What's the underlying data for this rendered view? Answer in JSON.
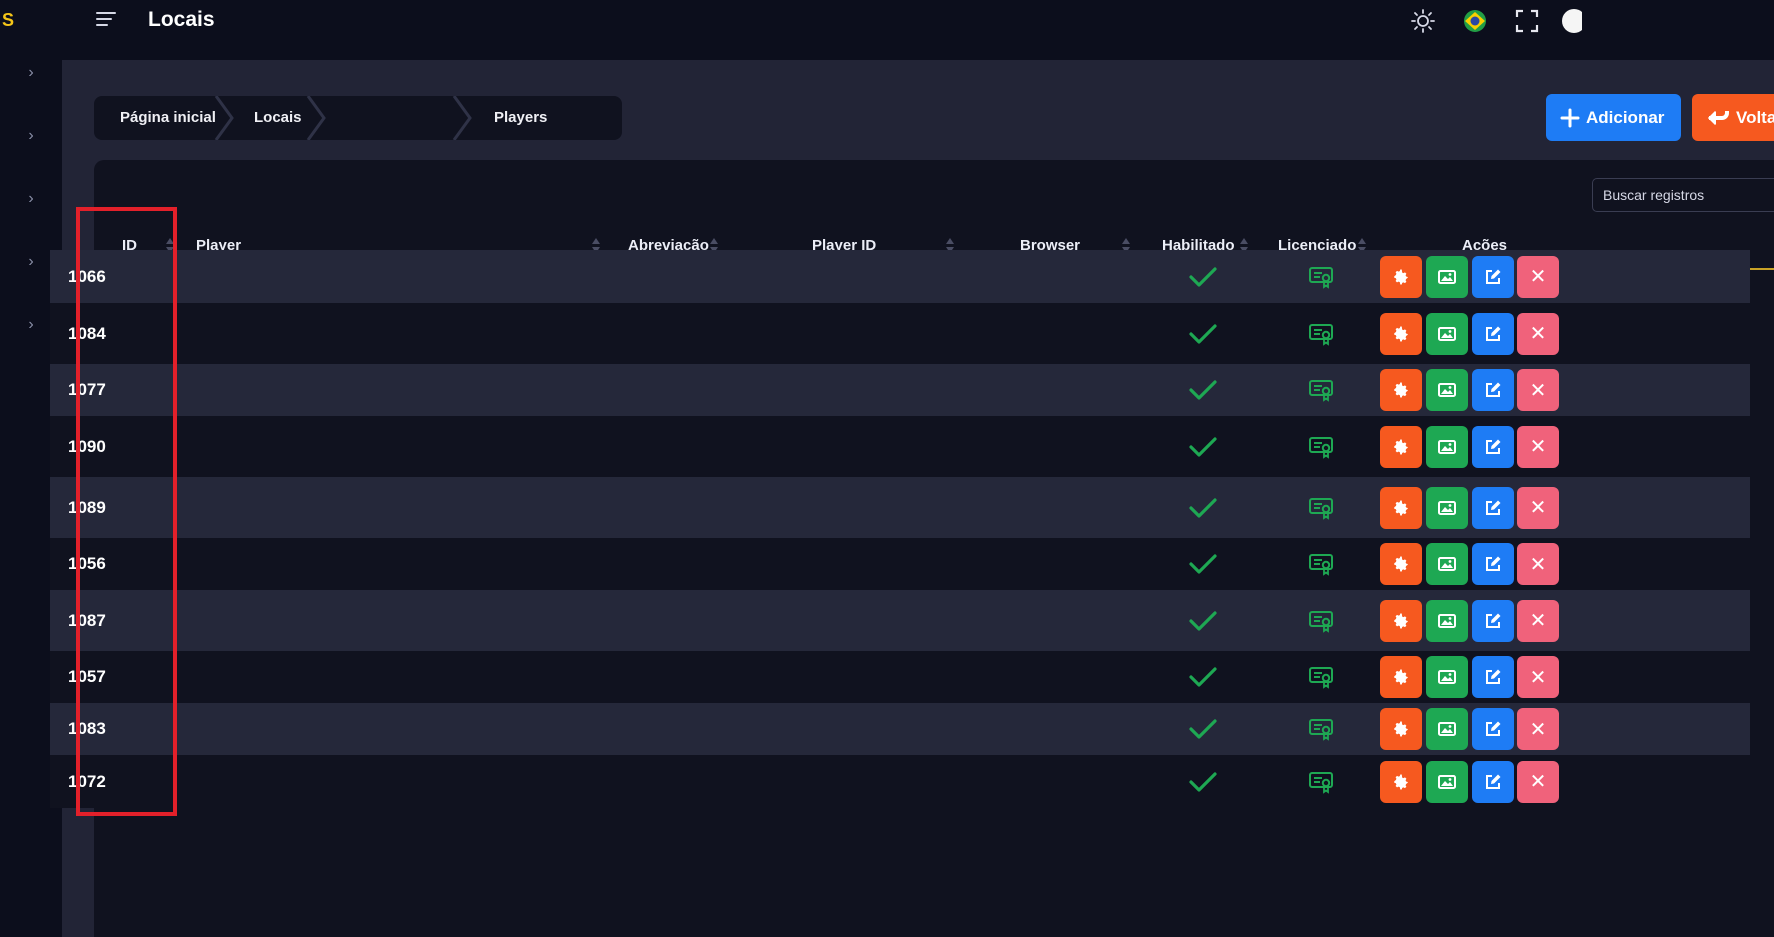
{
  "app": {
    "logo_text": "S",
    "title": "Locais"
  },
  "topbar": {
    "icons": [
      "sun-icon",
      "brazil-flag-icon",
      "fullscreen-icon",
      "avatar"
    ]
  },
  "breadcrumb": {
    "items": [
      "Página inicial",
      "Locais",
      "",
      "Players"
    ]
  },
  "actions": {
    "add_label": "Adicionar",
    "back_label": "Volta"
  },
  "search": {
    "placeholder": "Buscar registros"
  },
  "table": {
    "columns": [
      "ID",
      "Player",
      "Abreviação",
      "Player ID",
      "Browser",
      "Habilitado",
      "Licenciado",
      "Ações"
    ],
    "rows": [
      {
        "id": "1066",
        "player": "",
        "abreviacao": "",
        "player_id": "",
        "browser": "",
        "habilitado": true,
        "licenciado": true
      },
      {
        "id": "1084",
        "player": "",
        "abreviacao": "",
        "player_id": "",
        "browser": "",
        "habilitado": true,
        "licenciado": true
      },
      {
        "id": "1077",
        "player": "",
        "abreviacao": "",
        "player_id": "",
        "browser": "",
        "habilitado": true,
        "licenciado": true
      },
      {
        "id": "1090",
        "player": "",
        "abreviacao": "",
        "player_id": "",
        "browser": "",
        "habilitado": true,
        "licenciado": true
      },
      {
        "id": "1089",
        "player": "",
        "abreviacao": "",
        "player_id": "",
        "browser": "",
        "habilitado": true,
        "licenciado": true
      },
      {
        "id": "1056",
        "player": "",
        "abreviacao": "",
        "player_id": "",
        "browser": "",
        "habilitado": true,
        "licenciado": true
      },
      {
        "id": "1087",
        "player": "",
        "abreviacao": "",
        "player_id": "",
        "browser": "",
        "habilitado": true,
        "licenciado": true
      },
      {
        "id": "1057",
        "player": "",
        "abreviacao": "",
        "player_id": "",
        "browser": "",
        "habilitado": true,
        "licenciado": true
      },
      {
        "id": "1083",
        "player": "",
        "abreviacao": "",
        "player_id": "",
        "browser": "",
        "habilitado": true,
        "licenciado": true
      },
      {
        "id": "1072",
        "player": "",
        "abreviacao": "",
        "player_id": "",
        "browser": "",
        "habilitado": true,
        "licenciado": true
      }
    ],
    "row_actions": [
      "settings-icon",
      "image-icon",
      "edit-icon",
      "close-icon"
    ]
  },
  "colors": {
    "accent_blue": "#1e7cf5",
    "accent_orange": "#f6591f",
    "accent_green": "#1ea853",
    "accent_red": "#f0627b",
    "header_underline": "#c9a227",
    "highlight_box": "#e3202a"
  }
}
